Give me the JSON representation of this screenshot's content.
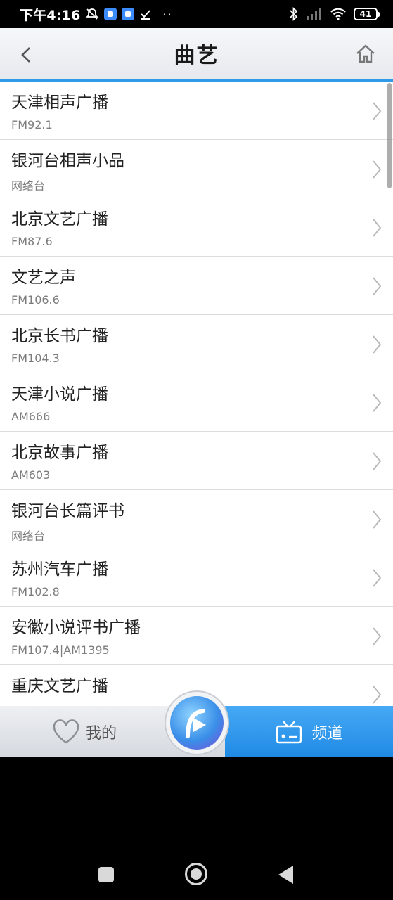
{
  "status_bar": {
    "time": "下午4:16",
    "battery": "41",
    "dots": "··"
  },
  "header": {
    "title": "曲艺"
  },
  "stations": [
    {
      "name": "天津相声广播",
      "sub": "FM92.1"
    },
    {
      "name": "银河台相声小品",
      "sub": "网络台"
    },
    {
      "name": "北京文艺广播",
      "sub": "FM87.6"
    },
    {
      "name": "文艺之声",
      "sub": "FM106.6"
    },
    {
      "name": "北京长书广播",
      "sub": "FM104.3"
    },
    {
      "name": "天津小说广播",
      "sub": "AM666"
    },
    {
      "name": "北京故事广播",
      "sub": "AM603"
    },
    {
      "name": "银河台长篇评书",
      "sub": "网络台"
    },
    {
      "name": "苏州汽车广播",
      "sub": "FM102.8"
    },
    {
      "name": "安徽小说评书广播",
      "sub": "FM107.4|AM1395"
    },
    {
      "name": "重庆文艺广播",
      "sub": ""
    }
  ],
  "tabs": {
    "mine_label": "我的",
    "channel_label": "频道"
  },
  "colors": {
    "accent": "#2f9be8",
    "channel_tab": "#1f8ae4"
  }
}
